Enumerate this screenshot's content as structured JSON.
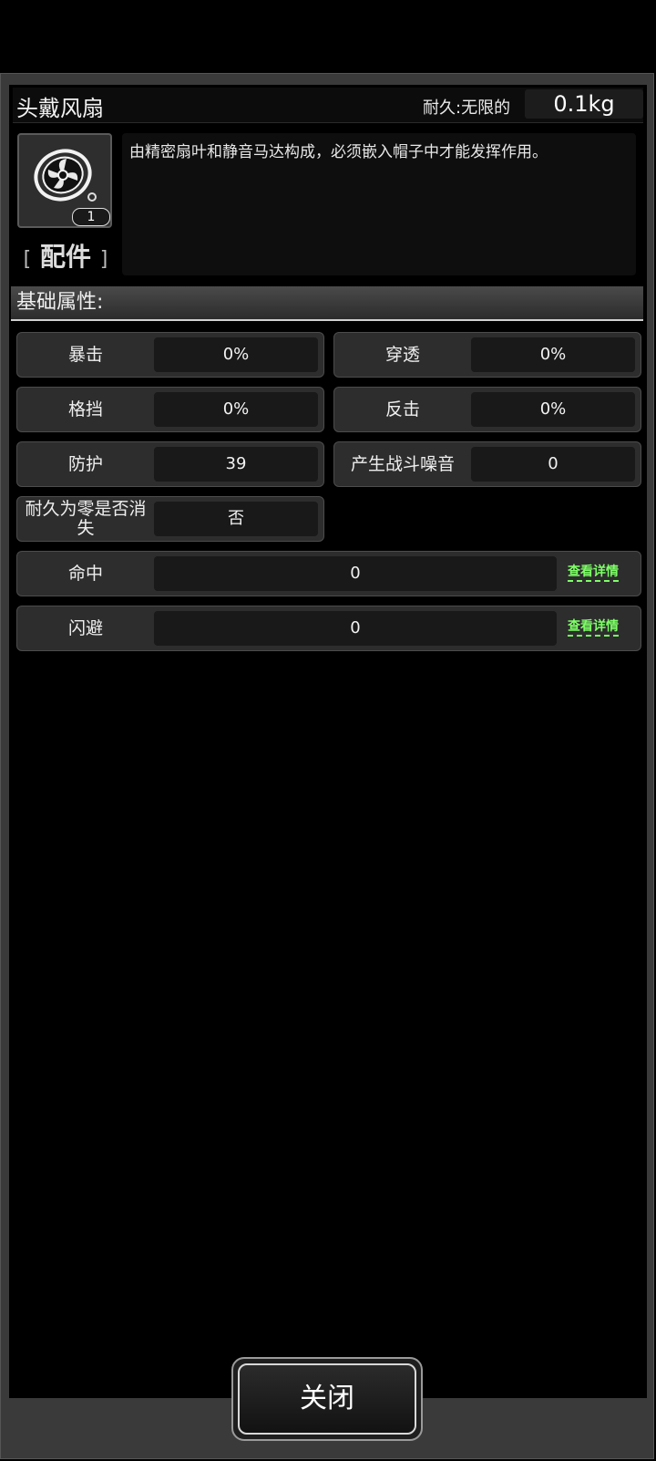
{
  "item": {
    "name": "头戴风扇",
    "durability_label": "耐久:无限的",
    "weight": "0.1kg",
    "count": "1",
    "category": "配件",
    "category_open": "[",
    "category_close": "]",
    "description": "由精密扇叶和静音马达构成，必须嵌入帽子中才能发挥作用。"
  },
  "section": {
    "title": "基础属性:"
  },
  "stats": [
    {
      "label": "暴击",
      "value": "0%"
    },
    {
      "label": "穿透",
      "value": "0%"
    },
    {
      "label": "格挡",
      "value": "0%"
    },
    {
      "label": "反击",
      "value": "0%"
    },
    {
      "label": "防护",
      "value": "39"
    },
    {
      "label": "产生战斗噪音",
      "value": "0"
    },
    {
      "label": "耐久为零是否消失",
      "value": "否"
    },
    {
      "label": "命中",
      "value": "0",
      "link": "查看详情"
    },
    {
      "label": "闪避",
      "value": "0",
      "link": "查看详情"
    }
  ],
  "footer": {
    "close_label": "关闭"
  },
  "colors": {
    "link": "#7dff66",
    "background": "#000000",
    "panel": "#3a3a3a"
  }
}
